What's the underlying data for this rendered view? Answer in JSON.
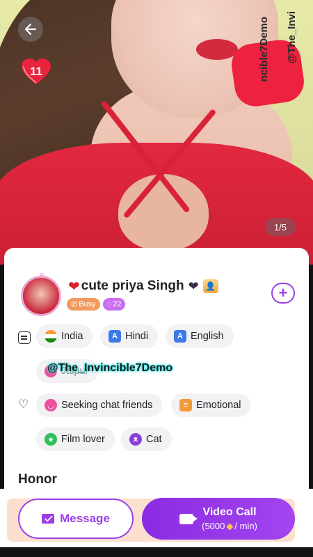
{
  "hero": {
    "like_count": "11",
    "page_indicator": "1/5",
    "watermark_lines": [
      "@The_Invi",
      "ncible7Demo"
    ]
  },
  "profile": {
    "name": "cute priya Singh",
    "status": "Busy",
    "count": "22",
    "languages": [
      {
        "label": "India",
        "icon": "india-flag-icon"
      },
      {
        "label": "Hindi",
        "icon": "language-a-icon"
      },
      {
        "label": "English",
        "icon": "language-a-icon"
      }
    ],
    "city": "Jaipur",
    "watermark": "@The_Invincible7Demo",
    "interests": [
      {
        "label": "Seeking chat friends",
        "icon": "smile-heart-icon"
      },
      {
        "label": "Emotional",
        "icon": "emotional-icon"
      },
      {
        "label": "Film lover",
        "icon": "star-face-icon"
      },
      {
        "label": "Cat",
        "icon": "cat-icon"
      }
    ],
    "section_title": "Honor"
  },
  "actions": {
    "message_label": "Message",
    "call_label": "Video Call",
    "price_prefix": "(5000",
    "price_suffix": "/ min)"
  },
  "colors": {
    "accent": "#9b3ee8",
    "busy": "#f29a5e",
    "count_badge": "#c86ff0"
  }
}
